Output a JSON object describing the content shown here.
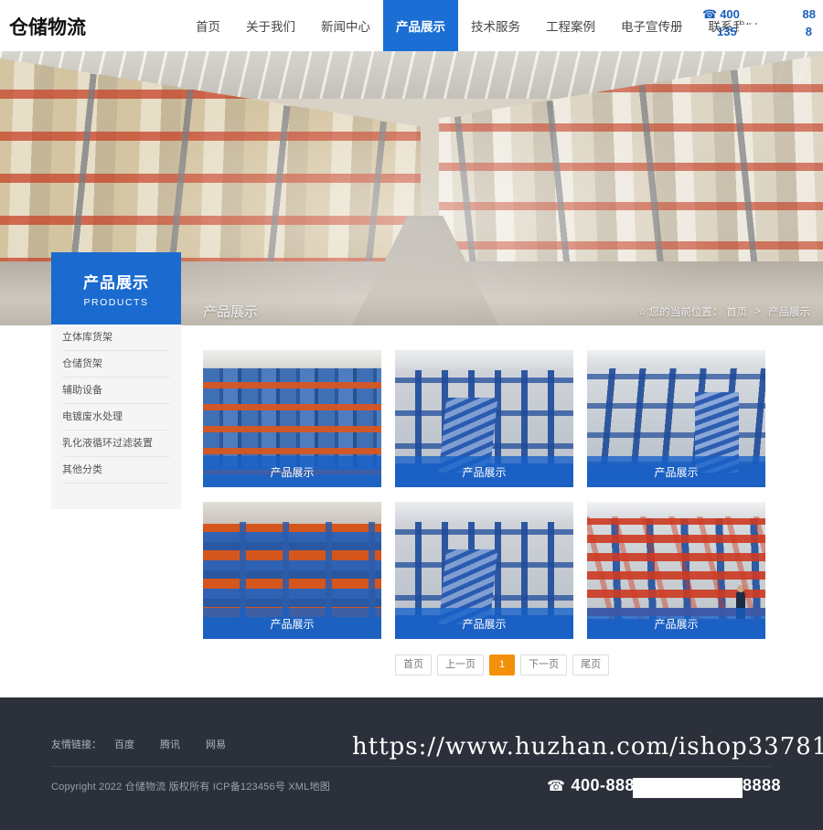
{
  "header": {
    "logo": "仓储物流",
    "nav": [
      {
        "label": "首页",
        "active": false
      },
      {
        "label": "关于我们",
        "active": false
      },
      {
        "label": "新闻中心",
        "active": false
      },
      {
        "label": "产品展示",
        "active": true
      },
      {
        "label": "技术服务",
        "active": false
      },
      {
        "label": "工程案例",
        "active": false
      },
      {
        "label": "电子宣传册",
        "active": false
      },
      {
        "label": "联系我们",
        "active": false
      }
    ],
    "phone_icon": "☎",
    "phone_line1": "400",
    "phone_line1_tail": "88",
    "phone_line2": "135",
    "phone_line2_tail": "8"
  },
  "hero": {
    "caption": "产品展示",
    "breadcrumb": {
      "home_icon": "⌂",
      "label": "您的当前位置：",
      "items": [
        "首页",
        "产品展示"
      ],
      "separator": ">"
    }
  },
  "sidebar": {
    "title": "产品展示",
    "subtitle": "PRODUCTS",
    "items": [
      {
        "label": "立体库货架"
      },
      {
        "label": "仓储货架"
      },
      {
        "label": "辅助设备"
      },
      {
        "label": "电镀废水处理"
      },
      {
        "label": "乳化液循环过滤装置"
      },
      {
        "label": "其他分类"
      }
    ]
  },
  "products": [
    {
      "caption": "产品展示",
      "style": "img-totes"
    },
    {
      "caption": "产品展示",
      "style": "img-mezz"
    },
    {
      "caption": "产品展示",
      "style": "img-mezz2"
    },
    {
      "caption": "产品展示",
      "style": "img-shelf"
    },
    {
      "caption": "产品展示",
      "style": "img-mezz"
    },
    {
      "caption": "产品展示",
      "style": "img-drive"
    }
  ],
  "pagination": {
    "first": "首页",
    "prev": "上一页",
    "current": "1",
    "next": "下一页",
    "last": "尾页"
  },
  "footer": {
    "links_label": "友情链接：",
    "links": [
      {
        "label": "百度"
      },
      {
        "label": "腾讯"
      },
      {
        "label": "网易"
      }
    ],
    "copyright": "Copyright 2022 仓储物流 版权所有 ICP备123456号 XML地图",
    "phone_icon": "☎",
    "phone": "400-888",
    "phone_tail": "8888",
    "watermark": "https://www.huzhan.com/ishop33781"
  },
  "colors": {
    "nav_active": "#1b6fd4",
    "sidebar_header": "#1a6ad0",
    "caption_overlay": "#1660c8",
    "pager_active": "#f39009",
    "footer_bg": "#2b303a",
    "header_phone": "#1b5fbd"
  }
}
